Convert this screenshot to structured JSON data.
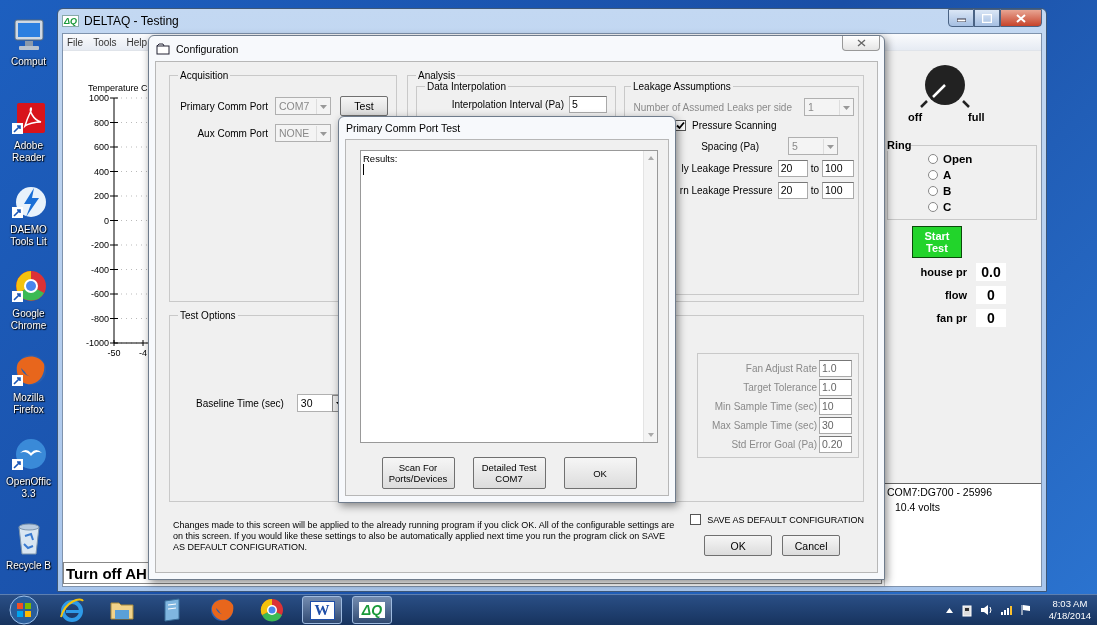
{
  "desktop_icons": [
    {
      "kind": "computer",
      "lines": [
        "Comput"
      ]
    },
    {
      "kind": "pdf",
      "lines": [
        "Adobe",
        "Reader"
      ]
    },
    {
      "kind": "daemon",
      "lines": [
        "DAEMO",
        "Tools Lit"
      ]
    },
    {
      "kind": "chrome",
      "lines": [
        "Google",
        "Chrome"
      ]
    },
    {
      "kind": "firefox",
      "lines": [
        "Mozilla",
        "Firefox"
      ]
    },
    {
      "kind": "openoffice",
      "lines": [
        "OpenOffic",
        "3.3"
      ]
    },
    {
      "kind": "recycle",
      "lines": [
        "Recycle B"
      ]
    }
  ],
  "main_window": {
    "title": "DELTAQ - Testing",
    "logo": "ΔQ",
    "menu": [
      "File",
      "Tools",
      "Help"
    ],
    "chart": {
      "chart_data": {
        "type": "line",
        "title": "Temperature C",
        "categories": [
          "-50",
          "-4"
        ],
        "grid": true,
        "ylim": [
          -1000,
          1000
        ],
        "yticks": [
          1000,
          800,
          600,
          400,
          200,
          0,
          -200,
          -400,
          -600,
          -800,
          -1000
        ]
      }
    },
    "status_message": "Turn off AH",
    "knob": {
      "min_label": "off",
      "max_label": "full"
    },
    "ring": {
      "title": "Ring",
      "options": [
        {
          "label": "Open",
          "selected": false
        },
        {
          "label": "A",
          "selected": false
        },
        {
          "label": "B",
          "selected": false
        },
        {
          "label": "C",
          "selected": false
        }
      ]
    },
    "start_button": "Start Test",
    "readouts": [
      {
        "label": "house pr",
        "value": "0.0"
      },
      {
        "label": "flow",
        "value": "0"
      },
      {
        "label": "fan pr",
        "value": "0"
      }
    ],
    "device_status": [
      "COM7:DG700 - 25996",
      "10.4 volts"
    ]
  },
  "configuration": {
    "title": "Configuration",
    "acquisition": {
      "title": "Acquisition",
      "rows": [
        {
          "label": "Primary Comm Port",
          "value": "COM7",
          "disabled": true,
          "button": "Test"
        },
        {
          "label": "Aux Comm Port",
          "value": "NONE",
          "disabled": true
        }
      ]
    },
    "analysis": {
      "title": "Analysis",
      "data_interpolation": {
        "title": "Data Interpolation",
        "field": {
          "label": "Interpolation Interval (Pa)",
          "value": "5"
        }
      },
      "leakage": {
        "title": "Leakage Assumptions",
        "leaks": {
          "label": "Number of Assumed Leaks per side",
          "value": "1",
          "disabled": true
        },
        "pressure_scanning": {
          "label": "Pressure Scanning",
          "checked": true
        },
        "spacing": {
          "label": "Spacing (Pa)",
          "value": "5",
          "disabled": true
        },
        "ranges": [
          {
            "label": "ly Leakage Pressure",
            "from": "20",
            "to_label": "to",
            "to": "100"
          },
          {
            "label": "rn Leakage Pressure",
            "from": "20",
            "to_label": "to",
            "to": "100"
          }
        ]
      }
    },
    "test_options": {
      "title": "Test Options",
      "baseline": {
        "label": "Baseline Time (sec)",
        "value": "30",
        "disabled": false
      },
      "fan_fields": [
        {
          "label": "Fan Adjust Rate",
          "value": "1.0",
          "disabled": true
        },
        {
          "label": "Target Tolerance",
          "value": "1.0",
          "disabled": true
        },
        {
          "label": "Min Sample Time (sec)",
          "value": "10",
          "disabled": true
        },
        {
          "label": "Max Sample Time (sec)",
          "value": "30",
          "disabled": true
        },
        {
          "label": "Std Error Goal (Pa)",
          "value": "0.20",
          "disabled": true
        }
      ]
    },
    "note": "Changes made to this screen will be applied to the already running program if you click OK. All of the configurable settings are on this screen. If you would like these settings to also be automatically applied next time you run the program click on SAVE AS DEFAULT CONFIGURATION.",
    "save_default": {
      "label": "SAVE AS DEFAULT CONFIGURATION",
      "checked": false
    },
    "buttons": [
      "OK",
      "Cancel"
    ]
  },
  "port_test": {
    "title": "Primary Comm Port Test",
    "results": "Results:",
    "buttons": [
      "Scan For Ports/Devices",
      "Detailed Test COM7",
      "OK"
    ]
  },
  "taskbar": {
    "items": [
      {
        "kind": "ie",
        "selected": false
      },
      {
        "kind": "folder",
        "selected": false
      },
      {
        "kind": "app",
        "selected": false
      },
      {
        "kind": "firefox",
        "selected": false
      },
      {
        "kind": "chrome",
        "selected": false
      },
      {
        "kind": "word",
        "label": "W",
        "selected": true
      },
      {
        "kind": "deltaq",
        "label": "ΔQ",
        "selected": true
      }
    ],
    "time": "8:03 AM",
    "date": "4/18/2014"
  }
}
